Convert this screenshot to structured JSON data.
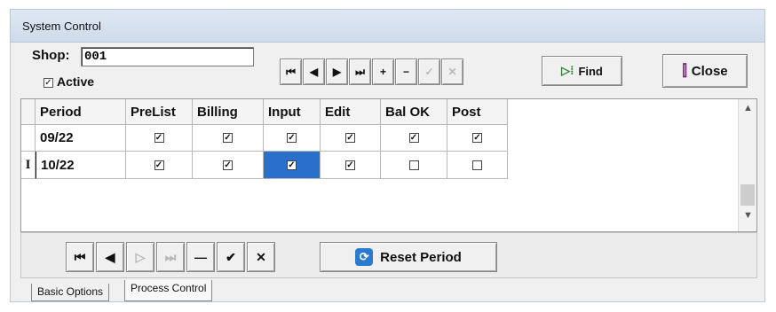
{
  "window": {
    "title": "System Control"
  },
  "header": {
    "shop_label": "Shop:",
    "shop_value": "001",
    "active_label": "Active",
    "active_checked": true
  },
  "toolbar": {
    "nav": [
      {
        "name": "first-record-button",
        "glyph": "⏮",
        "enabled": true
      },
      {
        "name": "prior-record-button",
        "glyph": "◀",
        "enabled": true
      },
      {
        "name": "next-record-button",
        "glyph": "▶",
        "enabled": true
      },
      {
        "name": "last-record-button",
        "glyph": "⏭",
        "enabled": true
      },
      {
        "name": "insert-record-button",
        "glyph": "+",
        "enabled": true
      },
      {
        "name": "delete-record-button",
        "glyph": "−",
        "enabled": true
      },
      {
        "name": "post-record-button",
        "glyph": "✓",
        "enabled": false
      },
      {
        "name": "cancel-record-button",
        "glyph": "✕",
        "enabled": false
      }
    ],
    "find_label": "Find",
    "close_label": "Close"
  },
  "grid": {
    "columns": [
      "Period",
      "PreList",
      "Billing",
      "Input",
      "Edit",
      "Bal OK",
      "Post"
    ],
    "rows": [
      {
        "indicator": "",
        "period": "09/22",
        "checks": [
          true,
          true,
          true,
          true,
          true,
          true
        ]
      },
      {
        "indicator": "I",
        "period": "10/22",
        "checks": [
          true,
          true,
          true,
          true,
          false,
          false
        ]
      }
    ],
    "selected_row": 1,
    "selected_col": 2
  },
  "bottom_nav": {
    "buttons": [
      {
        "name": "first-period-button",
        "glyph": "⏮",
        "enabled": true
      },
      {
        "name": "prior-period-button",
        "glyph": "◀",
        "enabled": true
      },
      {
        "name": "next-period-button",
        "glyph": "▷",
        "enabled": false
      },
      {
        "name": "last-period-button",
        "glyph": "⏭",
        "enabled": false
      },
      {
        "name": "delete-period-button",
        "glyph": "—",
        "enabled": true
      },
      {
        "name": "post-period-button",
        "glyph": "✔",
        "enabled": true
      },
      {
        "name": "cancel-period-button",
        "glyph": "✕",
        "enabled": true
      }
    ],
    "reset_label": "Reset Period"
  },
  "tabs": [
    "Basic Options",
    "Process Control"
  ],
  "active_tab": 1,
  "colors": {
    "selected_cell": "#2a6fc9",
    "titlebar": "#d4e0ee"
  }
}
